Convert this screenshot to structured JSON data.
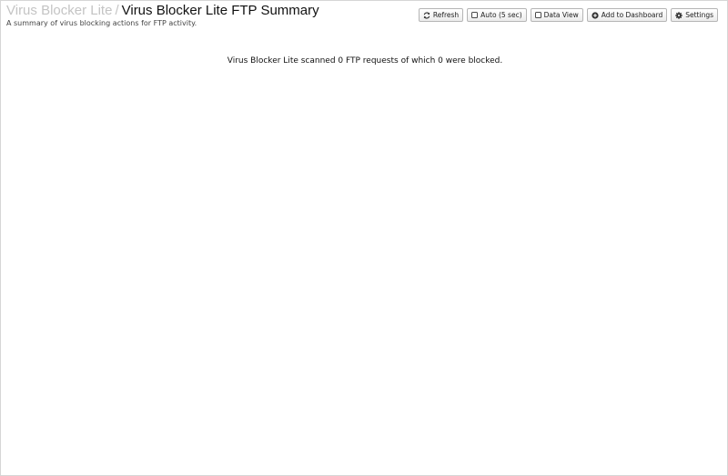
{
  "breadcrumb": {
    "parent": "Virus Blocker Lite",
    "separator": "/",
    "current": "Virus Blocker Lite FTP Summary"
  },
  "subtitle": "A summary of virus blocking actions for FTP activity.",
  "toolbar": {
    "refresh_label": "Refresh",
    "auto_label": "Auto (5 sec)",
    "data_view_label": "Data View",
    "add_dashboard_label": "Add to Dashboard",
    "settings_label": "Settings"
  },
  "summary_text": "Virus Blocker Lite scanned 0 FTP requests of which 0 were blocked.",
  "icons": {
    "refresh": "refresh-icon",
    "auto": "checkbox-icon",
    "data_view": "checkbox-icon",
    "add_dashboard": "plus-circle-icon",
    "settings": "gear-icon"
  }
}
